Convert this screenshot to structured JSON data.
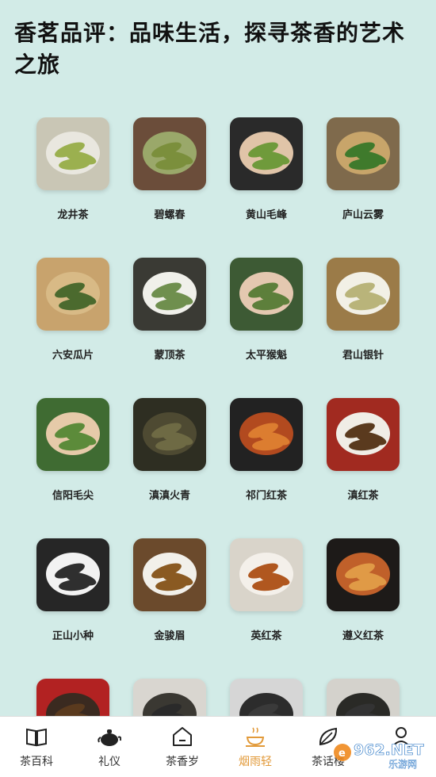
{
  "header": {
    "title": "香茗品评：品味生活，探寻茶香的艺术之旅"
  },
  "teas": [
    {
      "name": "龙井茶",
      "bg": "#c9c6b5",
      "inner": "#e9e7df",
      "leaf": "#9bb04f"
    },
    {
      "name": "碧螺春",
      "bg": "#6b4d3a",
      "inner": "#9aa86a",
      "leaf": "#7b8f3c"
    },
    {
      "name": "黄山毛峰",
      "bg": "#2a2a2a",
      "inner": "#e0c4a8",
      "leaf": "#6f9a3b"
    },
    {
      "name": "庐山云雾",
      "bg": "#7f6a4c",
      "inner": "#c8a56a",
      "leaf": "#3f7a2c"
    },
    {
      "name": "六安瓜片",
      "bg": "#c8a36d",
      "inner": "#d8ba86",
      "leaf": "#4b6a2e"
    },
    {
      "name": "蒙顶茶",
      "bg": "#3a3a34",
      "inner": "#f0f0ea",
      "leaf": "#6f8f4e"
    },
    {
      "name": "太平猴魁",
      "bg": "#3d5a34",
      "inner": "#e4c8b0",
      "leaf": "#5d7f3b"
    },
    {
      "name": "君山银针",
      "bg": "#9b7b48",
      "inner": "#f2f0e6",
      "leaf": "#b9b47a"
    },
    {
      "name": "信阳毛尖",
      "bg": "#3f6b32",
      "inner": "#e6caa9",
      "leaf": "#5c8b3a"
    },
    {
      "name": "滇滇火青",
      "bg": "#2e2e22",
      "inner": "#4e4a32",
      "leaf": "#6e6a44"
    },
    {
      "name": "祁门红茶",
      "bg": "#222222",
      "inner": "#b24a1f",
      "leaf": "#dc7d30"
    },
    {
      "name": "滇红茶",
      "bg": "#a12a20",
      "inner": "#f0ede6",
      "leaf": "#5a3a1e"
    },
    {
      "name": "正山小种",
      "bg": "#262626",
      "inner": "#f2f2f2",
      "leaf": "#2f2f2f"
    },
    {
      "name": "金骏眉",
      "bg": "#6b4a2c",
      "inner": "#f2f0ea",
      "leaf": "#8a5a22"
    },
    {
      "name": "英红茶",
      "bg": "#d9d4ca",
      "inner": "#f4f0ea",
      "leaf": "#b0571f"
    },
    {
      "name": "遵义红茶",
      "bg": "#1d1a18",
      "inner": "#c0602a",
      "leaf": "#e09a46"
    },
    {
      "name": "",
      "bg": "#b22222",
      "inner": "#3a2a20",
      "leaf": "#5a3a1e"
    },
    {
      "name": "",
      "bg": "#d9d6d0",
      "inner": "#3a3832",
      "leaf": "#2a2a2a"
    },
    {
      "name": "",
      "bg": "#d6d6d6",
      "inner": "#2c2c2c",
      "leaf": "#3a3a3a"
    },
    {
      "name": "",
      "bg": "#d4d2cc",
      "inner": "#2a2a26",
      "leaf": "#333333"
    }
  ],
  "tabbar": {
    "tabs": [
      {
        "label": "茶百科",
        "icon": "book-icon"
      },
      {
        "label": "礼仪",
        "icon": "teapot-icon"
      },
      {
        "label": "茶香岁",
        "icon": "home-icon"
      },
      {
        "label": "烟雨轻",
        "icon": "tea-cup-icon",
        "active": true
      },
      {
        "label": "茶话楼",
        "icon": "leaf-icon"
      },
      {
        "label": "",
        "icon": "user-icon"
      }
    ],
    "active_color": "#e29a3a"
  },
  "watermark": {
    "text": "962.NET",
    "subtext": "乐游网"
  }
}
